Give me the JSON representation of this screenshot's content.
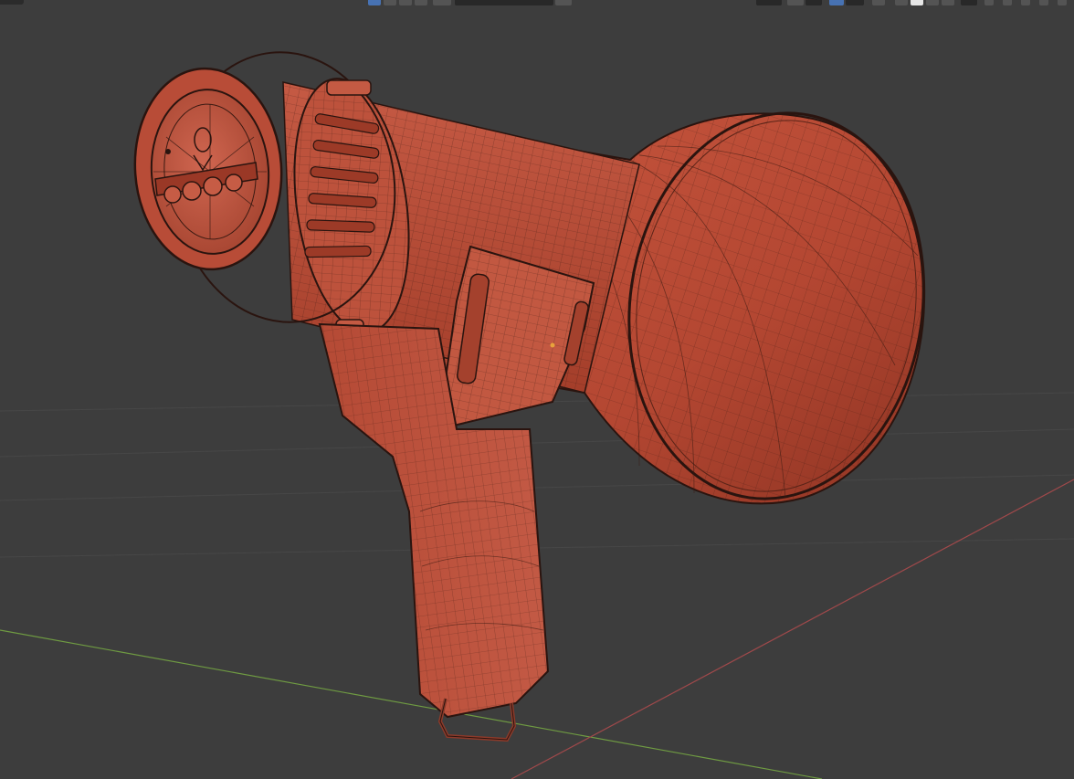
{
  "app": {
    "viewport": {
      "background": "#3d3d3d",
      "grid_color": "#474747",
      "x_axis_color": "#a0494b",
      "y_axis_color": "#6f9b42",
      "mesh_color": "#c5533f",
      "wire_color": "#2a140f",
      "origin_marker_color": "#e8a23c"
    },
    "header": {
      "left_icons": [
        "select-box-icon",
        "viewport-shading-icon",
        "overlay-icon",
        "gizmo-icon",
        "mesh-select-icon"
      ],
      "dropdown_value": "",
      "right_icons": [
        "transform-orientation-icon",
        "snap-icon",
        "proportional-edit-icon",
        "xray-icon",
        "wireframe-shading-icon",
        "solid-shading-icon",
        "material-shading-icon",
        "rendered-shading-icon",
        "shading-options-icon"
      ]
    }
  }
}
